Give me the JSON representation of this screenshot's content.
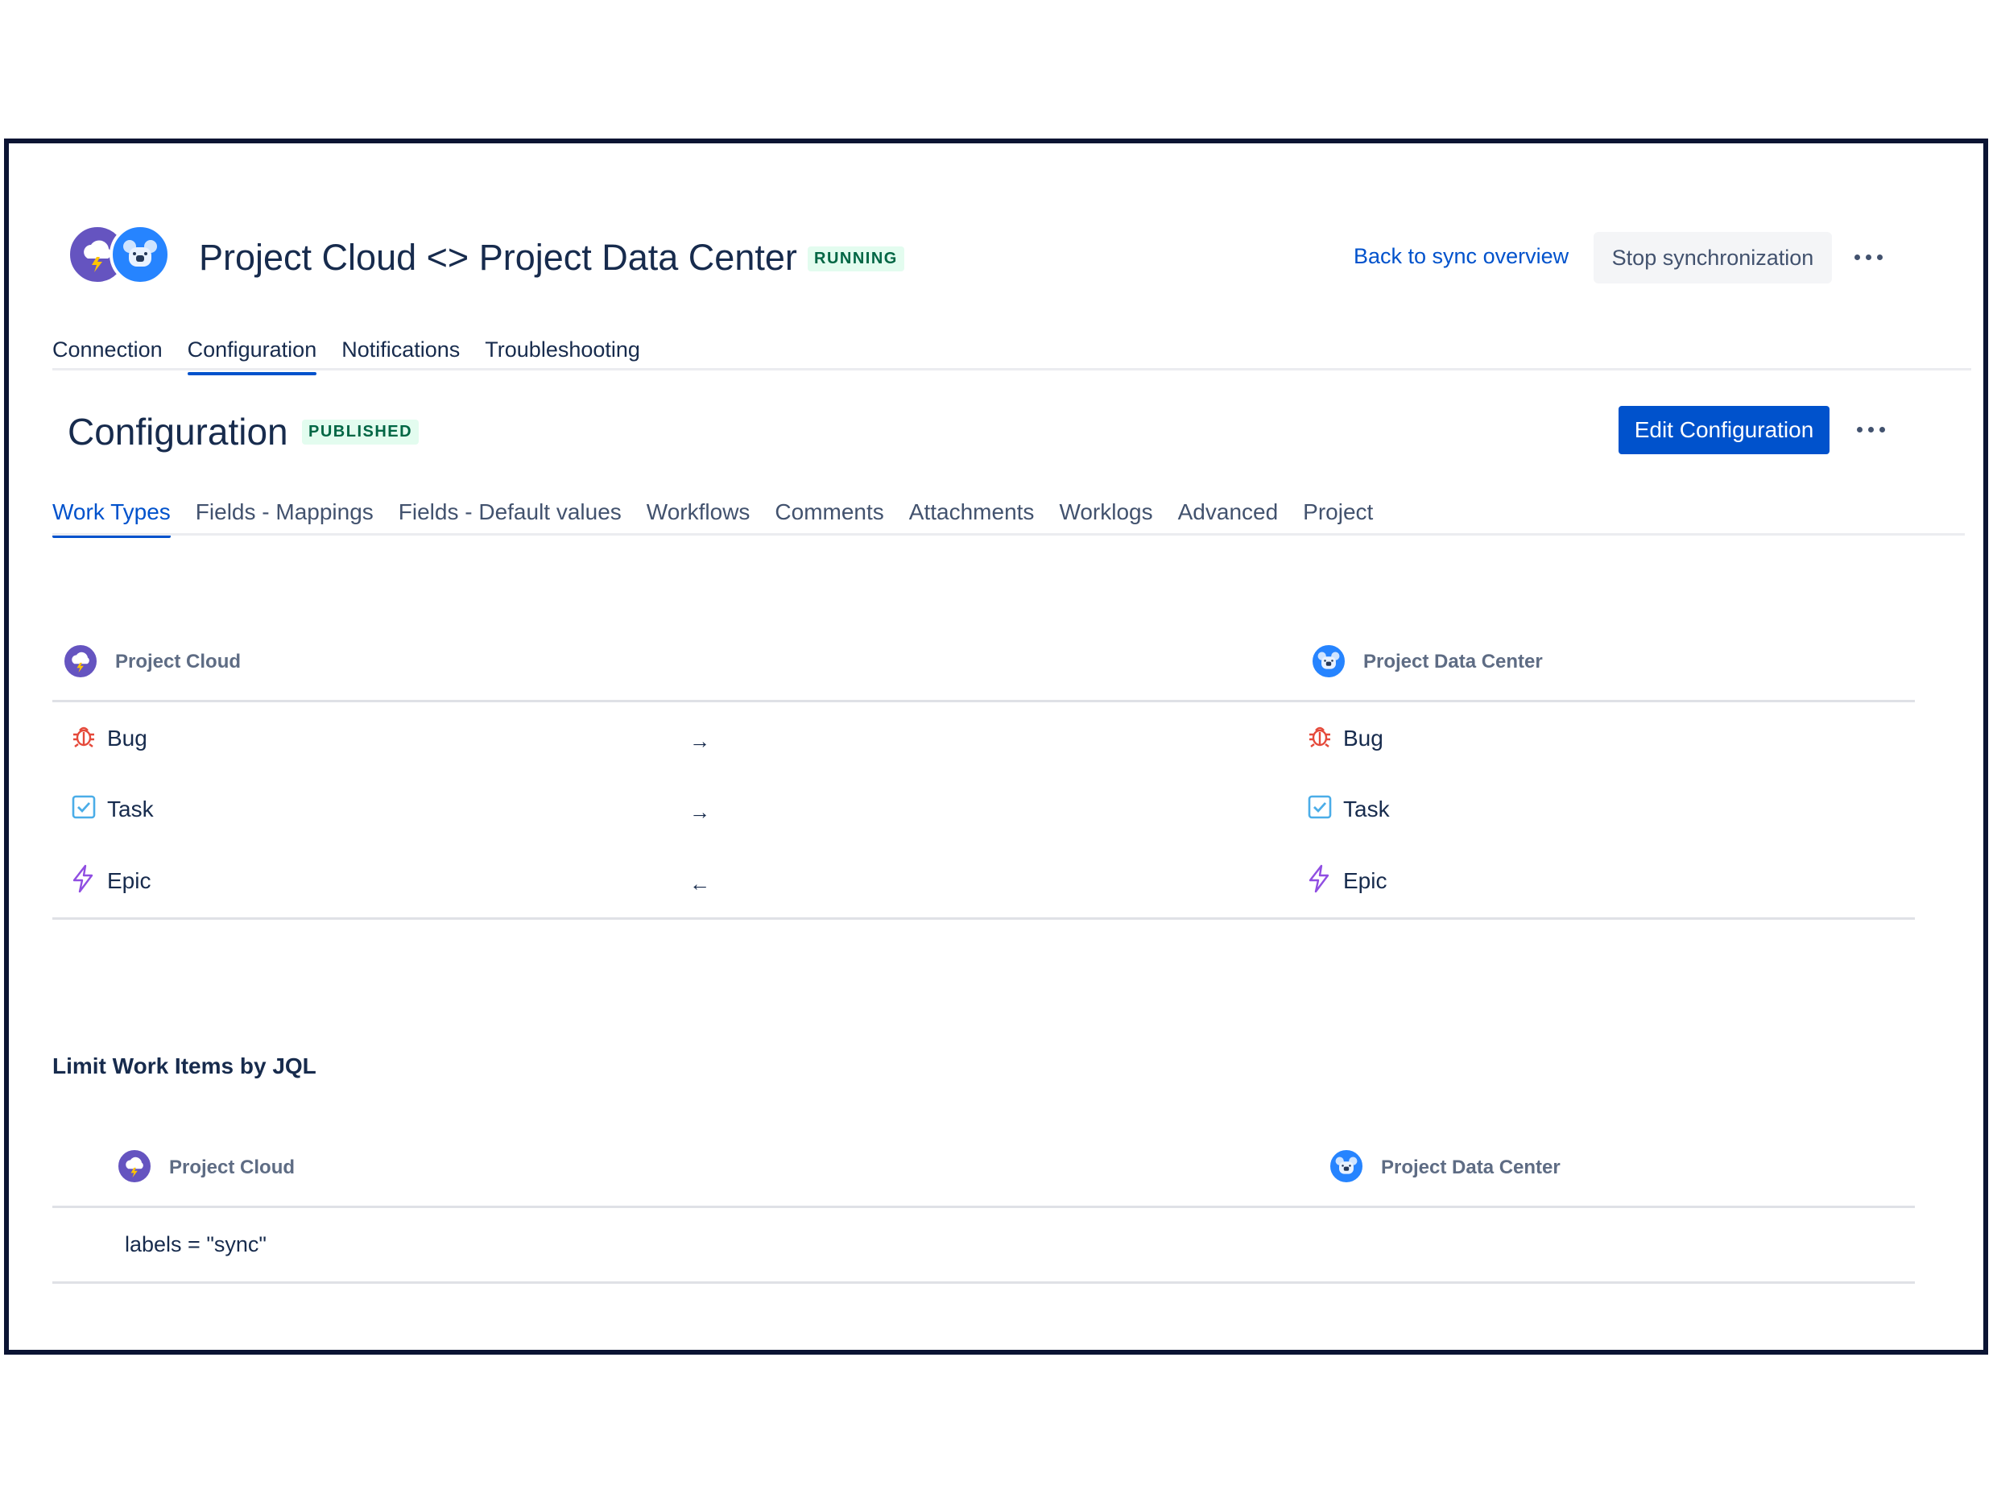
{
  "header": {
    "title": "Project Cloud <> Project Data Center",
    "status": "RUNNING",
    "back_link": "Back to sync overview",
    "stop_button": "Stop synchronization"
  },
  "main_tabs": [
    {
      "label": "Connection",
      "active": false
    },
    {
      "label": "Configuration",
      "active": true
    },
    {
      "label": "Notifications",
      "active": false
    },
    {
      "label": "Troubleshooting",
      "active": false
    }
  ],
  "configuration": {
    "title": "Configuration",
    "status": "PUBLISHED",
    "edit_button": "Edit Configuration"
  },
  "config_tabs": [
    {
      "label": "Work Types",
      "active": true
    },
    {
      "label": "Fields - Mappings",
      "active": false
    },
    {
      "label": "Fields - Default values",
      "active": false
    },
    {
      "label": "Workflows",
      "active": false
    },
    {
      "label": "Comments",
      "active": false
    },
    {
      "label": "Attachments",
      "active": false
    },
    {
      "label": "Worklogs",
      "active": false
    },
    {
      "label": "Advanced",
      "active": false
    },
    {
      "label": "Project",
      "active": false
    }
  ],
  "work_types": {
    "left_project": "Project Cloud",
    "right_project": "Project Data Center",
    "rows": [
      {
        "left": "Bug",
        "direction": "→",
        "right": "Bug",
        "icon": "bug-icon",
        "color": "#e5493a"
      },
      {
        "left": "Task",
        "direction": "→",
        "right": "Task",
        "icon": "task-icon",
        "color": "#4bade8"
      },
      {
        "left": "Epic",
        "direction": "←",
        "right": "Epic",
        "icon": "epic-icon",
        "color": "#904ee2"
      }
    ]
  },
  "jql": {
    "heading": "Limit Work Items by JQL",
    "left_project": "Project Cloud",
    "right_project": "Project Data Center",
    "left_query": "labels = \"sync\"",
    "right_query": ""
  },
  "colors": {
    "primary": "#0052cc",
    "running_bg": "#e3fcef",
    "running_text": "#006644",
    "cloud_avatar": "#6554c0",
    "datacenter_avatar": "#2684ff",
    "frame_border": "#0b1433"
  }
}
